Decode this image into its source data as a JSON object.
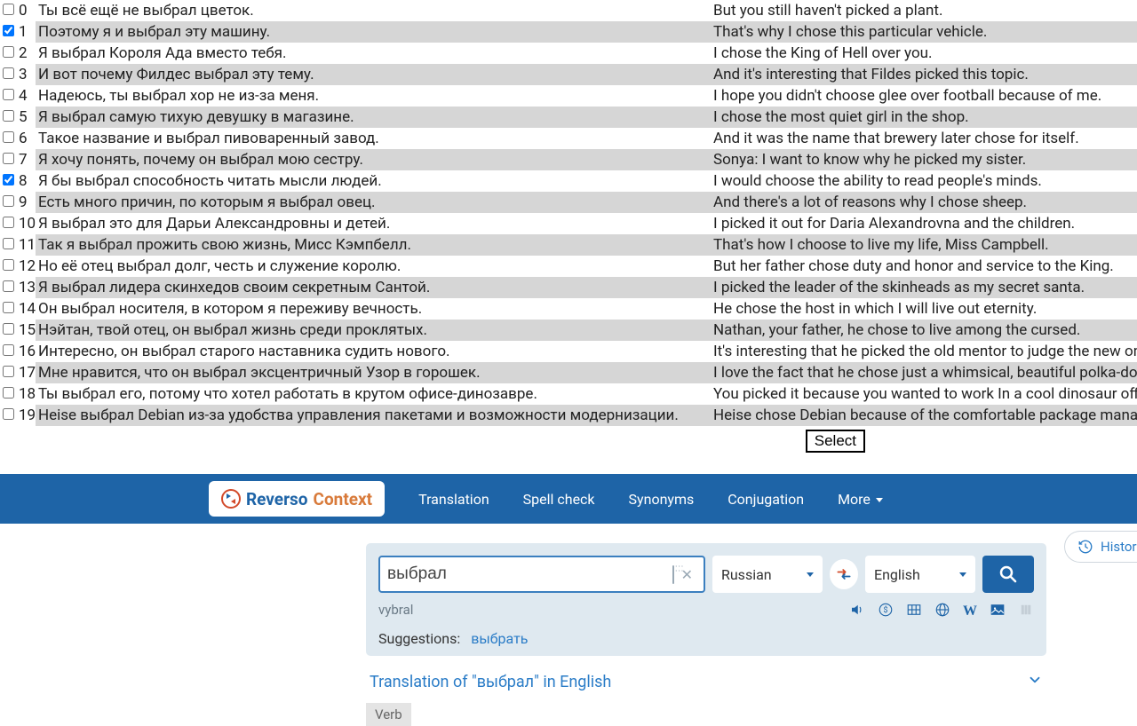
{
  "rows": [
    {
      "idx": 0,
      "checked": false,
      "src": "Ты всё ещё не выбрал цветок.",
      "tgt": "But you still haven't picked a plant."
    },
    {
      "idx": 1,
      "checked": true,
      "src": "Поэтому я и выбрал эту машину.",
      "tgt": "That's why I chose this particular vehicle."
    },
    {
      "idx": 2,
      "checked": false,
      "src": "Я выбрал Короля Ада вместо тебя.",
      "tgt": "I chose the King of Hell over you."
    },
    {
      "idx": 3,
      "checked": false,
      "src": "И вот почему Филдес выбрал эту тему.",
      "tgt": "And it's interesting that Fildes picked this topic."
    },
    {
      "idx": 4,
      "checked": false,
      "src": "Надеюсь, ты выбрал хор не из-за меня.",
      "tgt": "I hope you didn't choose glee over football because of me."
    },
    {
      "idx": 5,
      "checked": false,
      "src": "Я выбрал самую тихую девушку в магазине.",
      "tgt": "I chose the most quiet girl in the shop."
    },
    {
      "idx": 6,
      "checked": false,
      "src": "Такое название и выбрал пивоваренный завод.",
      "tgt": "And it was the name that brewery later chose for itself."
    },
    {
      "idx": 7,
      "checked": false,
      "src": "Я хочу понять, почему он выбрал мою сестру.",
      "tgt": "Sonya: I want to know why he picked my sister."
    },
    {
      "idx": 8,
      "checked": true,
      "src": "Я бы выбрал способность читать мысли людей.",
      "tgt": "I would choose the ability to read people's minds."
    },
    {
      "idx": 9,
      "checked": false,
      "src": "Есть много причин, по которым я выбрал овец.",
      "tgt": "And there's a lot of reasons why I chose sheep."
    },
    {
      "idx": 10,
      "checked": false,
      "src": "Я выбрал это для Дарьи Александровны и детей.",
      "tgt": "I picked it out for Daria Alexandrovna and the children."
    },
    {
      "idx": 11,
      "checked": false,
      "src": "Так я выбрал прожить свою жизнь, Мисс Кэмпбелл.",
      "tgt": "That's how I choose to live my life, Miss Campbell."
    },
    {
      "idx": 12,
      "checked": false,
      "src": "Но её отец выбрал долг, честь и служение королю.",
      "tgt": "But her father chose duty and honor and service to the King."
    },
    {
      "idx": 13,
      "checked": false,
      "src": "Я выбрал лидера скинхедов своим секретным Сантой.",
      "tgt": "I picked the leader of the skinheads as my secret santa."
    },
    {
      "idx": 14,
      "checked": false,
      "src": "Он выбрал носителя, в котором я переживу вечность.",
      "tgt": "He chose the host in which I will live out eternity."
    },
    {
      "idx": 15,
      "checked": false,
      "src": "Нэйтан, твой отец, он выбрал жизнь среди проклятых.",
      "tgt": "Nathan, your father, he chose to live among the cursed."
    },
    {
      "idx": 16,
      "checked": false,
      "src": "Интересно, он выбрал старого наставника судить нового.",
      "tgt": "It's interesting that he picked the old mentor to judge the new one."
    },
    {
      "idx": 17,
      "checked": false,
      "src": "Мне нравится, что он выбрал эксцентричный Узор в горошек.",
      "tgt": "I love the fact that he chose just a whimsical, beautiful polka-dot pattern."
    },
    {
      "idx": 18,
      "checked": false,
      "src": "Ты выбрал его, потому что хотел работать в крутом офисе-динозавре.",
      "tgt": "You picked it because you wanted to work In a cool dinosaur office."
    },
    {
      "idx": 19,
      "checked": false,
      "src": "Heise выбрал Debian из-за удобства управления пакетами и возможности модернизации.",
      "tgt": "Heise chose Debian because of the comfortable package management and upgrade ability."
    }
  ],
  "select_button": "Select",
  "logo": {
    "part1": "Reverso",
    "part2": "Context"
  },
  "nav": {
    "translation": "Translation",
    "spellcheck": "Spell check",
    "synonyms": "Synonyms",
    "conjugation": "Conjugation",
    "more": "More"
  },
  "search": {
    "value": "выбрал",
    "src_lang": "Russian",
    "tgt_lang": "English"
  },
  "translit": "vybral",
  "suggestions_label": "Suggestions:",
  "suggestion_link": "выбрать",
  "translation_header": "Translation of \"выбрал\" in English",
  "pos_tag": "Verb",
  "history_label": "History"
}
